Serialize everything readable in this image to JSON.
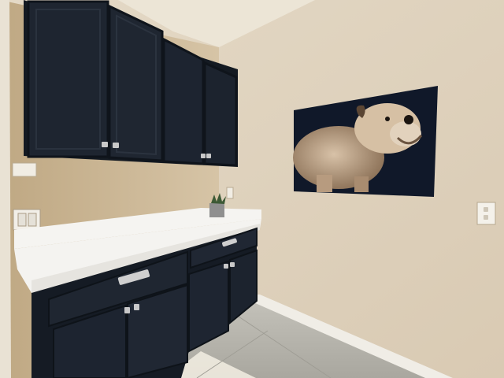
{
  "scene": {
    "subject": "kitchenette",
    "objects": [
      "upper-cabinets",
      "lower-cabinets",
      "countertop",
      "bulldog-canvas",
      "succulent-plant",
      "outlets",
      "tile-floor",
      "baseboard"
    ]
  },
  "colors": {
    "cabinet": "#1e2530",
    "cabinet_edge": "#11161e",
    "wall_right": "#e0d3bf",
    "wall_left": "#cdb896",
    "ceiling": "#ece5d6",
    "counter": "#f4f3f0",
    "floor": "#b9b6ad",
    "baseboard": "#f0ede6",
    "canvas_bg": "#101829"
  }
}
